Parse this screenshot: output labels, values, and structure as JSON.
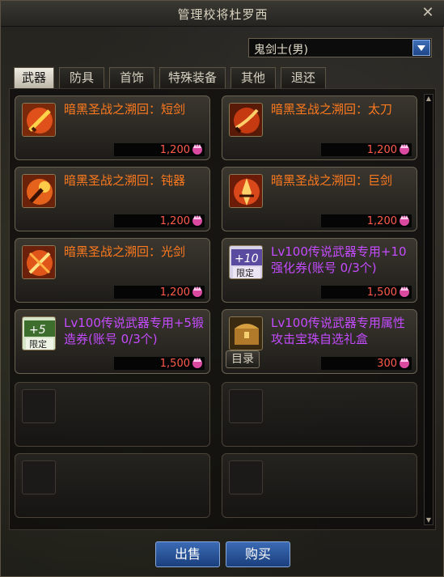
{
  "window": {
    "title": "管理校将杜罗西"
  },
  "class_select": {
    "value": "鬼剑士(男)"
  },
  "tabs": [
    {
      "label": "武器"
    },
    {
      "label": "防具"
    },
    {
      "label": "首饰"
    },
    {
      "label": "特殊装备"
    },
    {
      "label": "其他"
    },
    {
      "label": "退还"
    }
  ],
  "items": [
    {
      "name": "暗黑圣战之溯回：短剑",
      "price": "1,200",
      "color": "#ff7a1e",
      "icon": "short-sword-icon"
    },
    {
      "name": "暗黑圣战之溯回：太刀",
      "price": "1,200",
      "color": "#ff7a1e",
      "icon": "katana-icon"
    },
    {
      "name": "暗黑圣战之溯回：钝器",
      "price": "1,200",
      "color": "#ff7a1e",
      "icon": "blunt-weapon-icon"
    },
    {
      "name": "暗黑圣战之溯回：巨剑",
      "price": "1,200",
      "color": "#ff7a1e",
      "icon": "greatsword-icon"
    },
    {
      "name": "暗黑圣战之溯回：光剑",
      "price": "1,200",
      "color": "#ff7a1e",
      "icon": "lightsaber-icon"
    },
    {
      "name": "Lv100传说武器专用+10强化券(账号 0/3个)",
      "price": "1,500",
      "color": "#c44bff",
      "icon": "upgrade-ticket-icon",
      "icon_text": "+10",
      "badge": "限定"
    },
    {
      "name": "Lv100传说武器专用+5锻造券(账号 0/3个)",
      "price": "1,500",
      "color": "#c44bff",
      "icon": "forge-ticket-icon",
      "icon_text": "+5",
      "badge": "限定"
    },
    {
      "name": "Lv100传说武器专用属性攻击宝珠自选礼盒",
      "price": "300",
      "color": "#c44bff",
      "icon": "treasure-chest-icon",
      "catalog_label": "目录"
    }
  ],
  "buttons": {
    "sell": "出售",
    "buy": "购买"
  },
  "colors": {
    "orange_name": "#ff7a1e",
    "purple_name": "#c44bff",
    "price": "#ff5a4a",
    "button_blue": "#2a5599"
  }
}
